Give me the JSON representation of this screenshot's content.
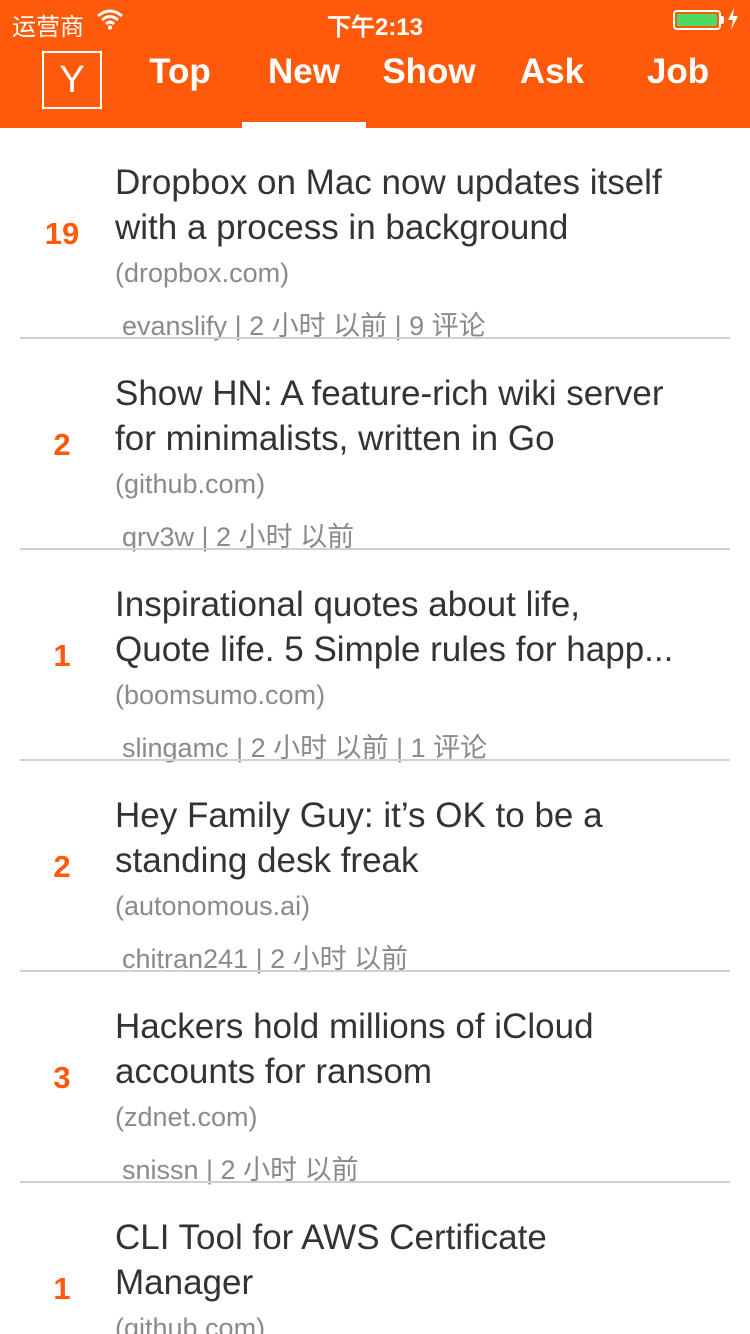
{
  "status_bar": {
    "carrier": "运营商",
    "time": "下午2:13",
    "battery_percent": 100,
    "battery_color": "#4cd964"
  },
  "header": {
    "logo": "Y",
    "tabs": [
      {
        "label": "Top",
        "selected": false
      },
      {
        "label": "New",
        "selected": true
      },
      {
        "label": "Show",
        "selected": false
      },
      {
        "label": "Ask",
        "selected": false
      },
      {
        "label": "Job",
        "selected": false
      }
    ],
    "accent_color": "#ff5a0a"
  },
  "stories": [
    {
      "points": "19",
      "title_lines": [
        "Dropbox on Mac now updates itself",
        "with a process in background"
      ],
      "domain": "(dropbox.com)",
      "user": "evanslify",
      "time": "| 2 小时 以前",
      "comments": "| 9 评论"
    },
    {
      "points": "2",
      "title_lines": [
        "Show HN: A feature-rich wiki server",
        "for minimalists, written in Go"
      ],
      "domain": "(github.com)",
      "user": "qrv3w",
      "time": "| 2 小时 以前",
      "comments": ""
    },
    {
      "points": "1",
      "title_lines": [
        "Inspirational quotes about life,",
        "Quote life. 5 Simple rules for happ..."
      ],
      "domain": "(boomsumo.com)",
      "user": "slingamc",
      "time": "| 2 小时 以前",
      "comments": "| 1 评论"
    },
    {
      "points": "2",
      "title_lines": [
        "Hey Family Guy: it’s OK to be a",
        "standing desk freak"
      ],
      "domain": "(autonomous.ai)",
      "user": "chitran241",
      "time": "| 2 小时 以前",
      "comments": ""
    },
    {
      "points": "3",
      "title_lines": [
        "Hackers hold millions of iCloud",
        "accounts for ransom"
      ],
      "domain": "(zdnet.com)",
      "user": "snissn",
      "time": "| 2 小时 以前",
      "comments": ""
    },
    {
      "points": "1",
      "title_lines": [
        "CLI Tool for AWS Certificate",
        "Manager"
      ],
      "domain": "(github.com)",
      "user": "",
      "time": "",
      "comments": ""
    }
  ]
}
